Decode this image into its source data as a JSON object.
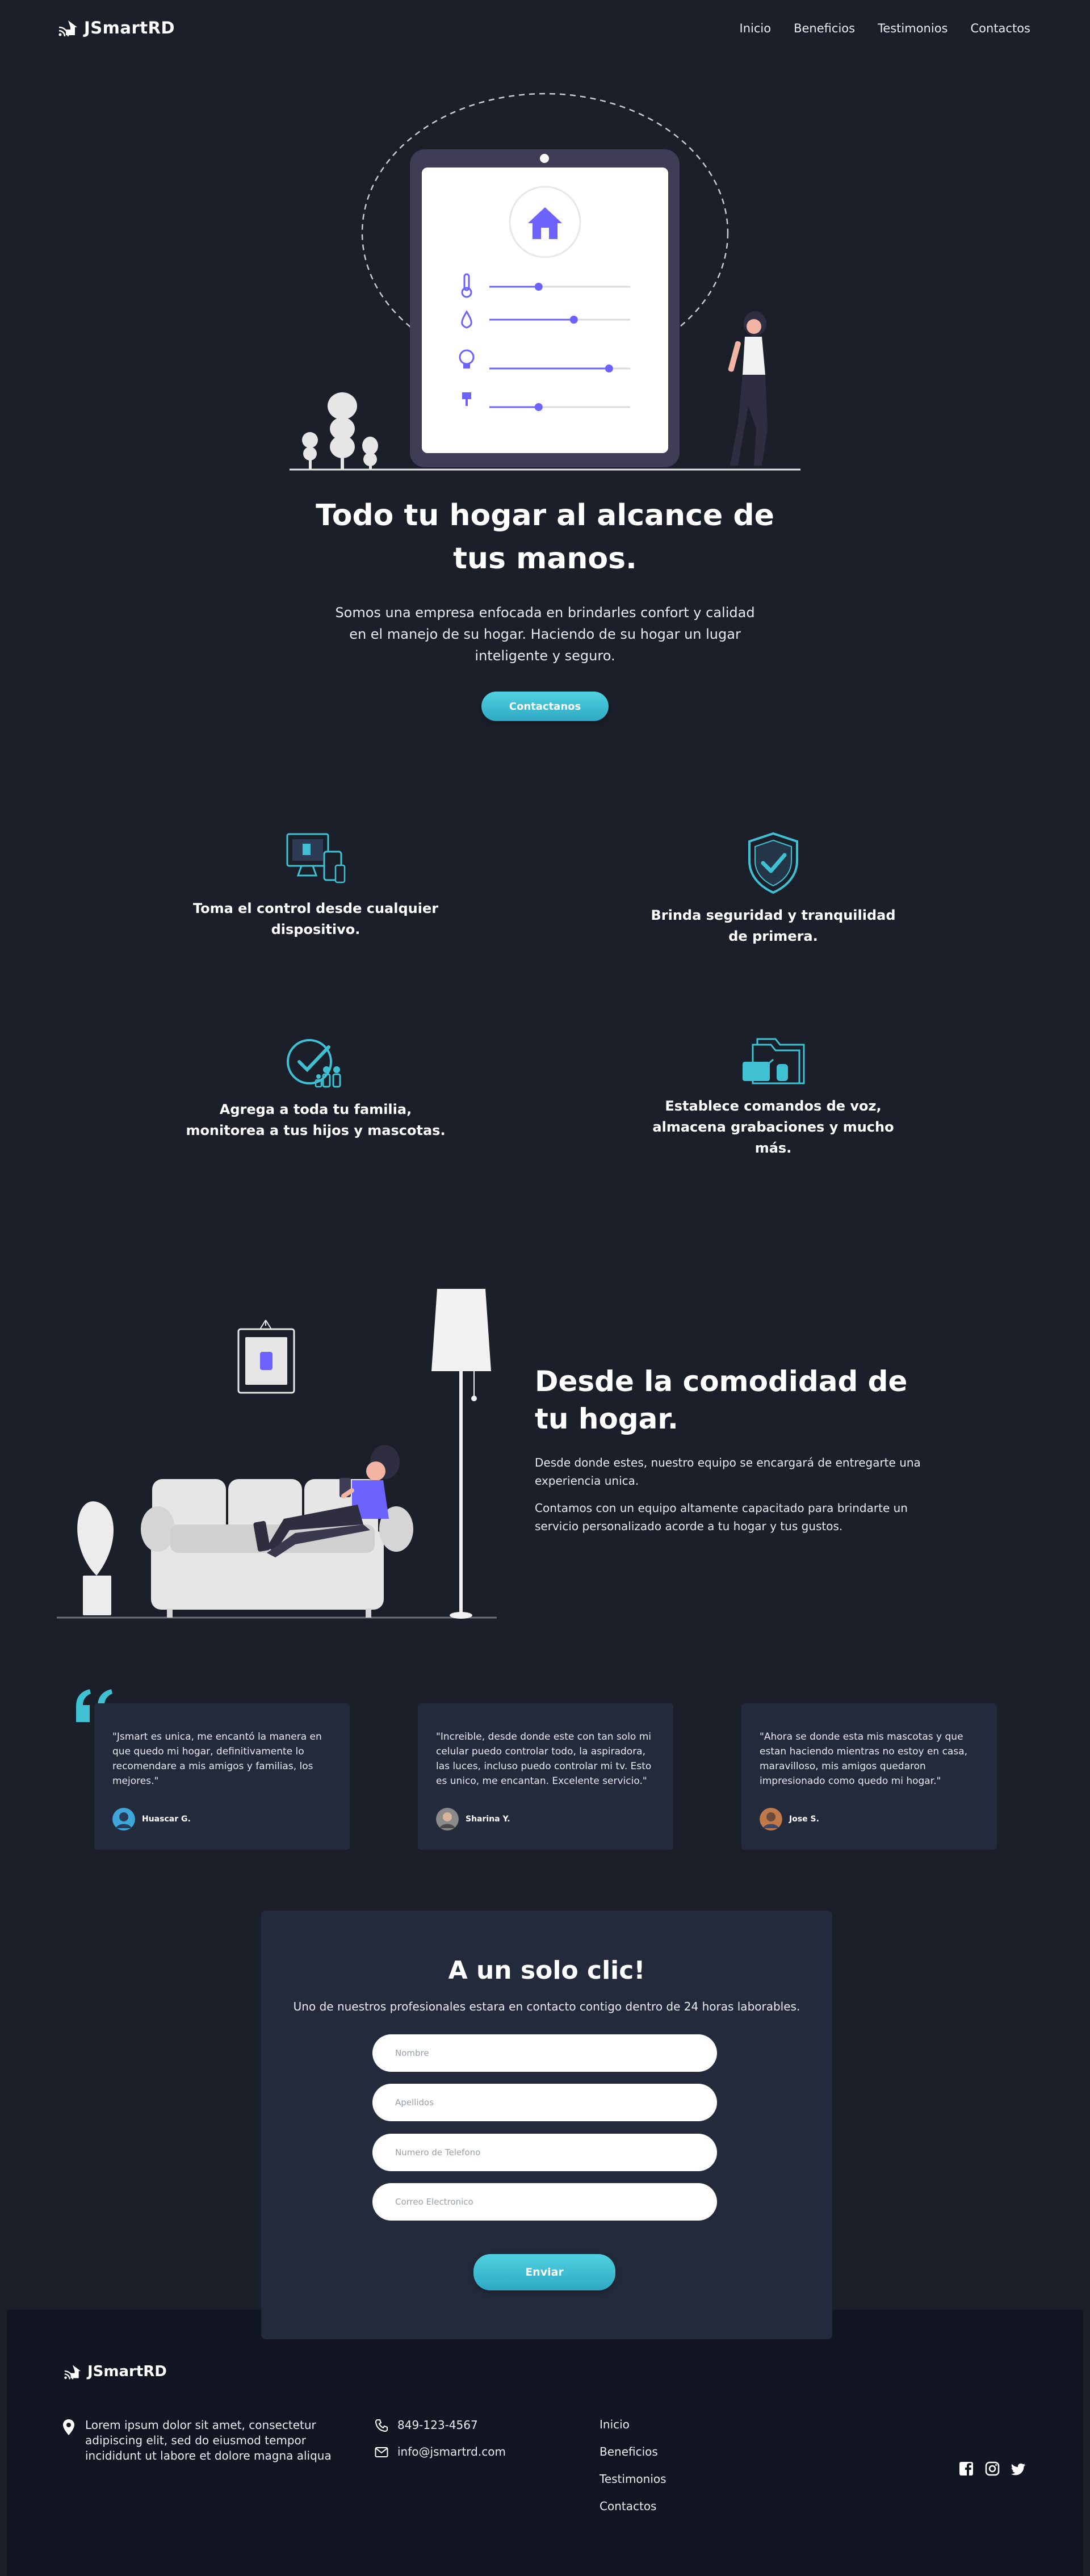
{
  "nav": {
    "brand": "JSmartRD",
    "links": [
      "Inicio",
      "Beneficios",
      "Testimonios",
      "Contactos"
    ]
  },
  "hero": {
    "title": "Todo tu hogar al alcance de tus manos.",
    "text": "Somos una empresa enfocada en brindarles confort y calidad en el manejo de su hogar. Haciendo de su hogar un lugar inteligente y seguro.",
    "button": "Contactanos",
    "sliders": [
      0.35,
      0.6,
      0.85,
      0.35
    ]
  },
  "features": [
    {
      "icon": "devices-icon",
      "text": "Toma el control desde cualquier dispositivo."
    },
    {
      "icon": "shield-check-icon",
      "text": "Brinda seguridad y tranquilidad de primera."
    },
    {
      "icon": "family-check-icon",
      "text": "Agrega a toda tu familia, monitorea a tus hijos y mascotas."
    },
    {
      "icon": "voice-folder-icon",
      "text": "Establece comandos de voz, almacena grabaciones y mucho más."
    }
  ],
  "about": {
    "title": "Desde la comodidad de tu hogar.",
    "p1": "Desde donde estes, nuestro equipo se encargará de entregarte una experiencia unica.",
    "p2": "Contamos con un equipo altamente capacitado para brindarte un servicio personalizado acorde a tu hogar y tus gustos."
  },
  "testimonials": [
    {
      "text": "\"Jsmart es unica, me encantó la manera en que quedo mi hogar, definitivamente lo recomendare a mis amigos y familias, los mejores.\"",
      "author": "Huascar G."
    },
    {
      "text": "\"Increible, desde donde este con tan solo mi celular puedo controlar todo, la aspiradora, las luces, incluso puedo controlar mi tv. Esto es unico, me encantan. Excelente servicio.\"",
      "author": "Sharina Y."
    },
    {
      "text": "\"Ahora se donde esta mis mascotas y que estan haciendo mientras no estoy en casa, maravilloso, mis amigos quedaron impresionado como quedo mi hogar.\"",
      "author": "Jose S."
    }
  ],
  "contact": {
    "title": "A un solo clic!",
    "subtitle": "Uno de nuestros profesionales estara en contacto contigo dentro de 24 horas laborables.",
    "placeholders": [
      "Nombre",
      "Apellidos",
      "Numero de Telefono",
      "Correo Electronico"
    ],
    "button": "Enviar"
  },
  "footer": {
    "brand": "JSmartRD",
    "address": "Lorem ipsum dolor sit amet, consectetur adipiscing elit, sed do eiusmod tempor incididunt ut labore et dolore magna aliqua",
    "phone": "849-123-4567",
    "email": "info@jsmartrd.com",
    "links": [
      "Inicio",
      "Beneficios",
      "Testimonios",
      "Contactos"
    ],
    "social": [
      "facebook-icon",
      "instagram-icon",
      "twitter-icon"
    ]
  },
  "colors": {
    "background": "#1b1f2a",
    "card": "#232a3b",
    "accent_purple": "#6c63ff",
    "accent_teal": "#3fc1d3",
    "footer": "#111622"
  }
}
